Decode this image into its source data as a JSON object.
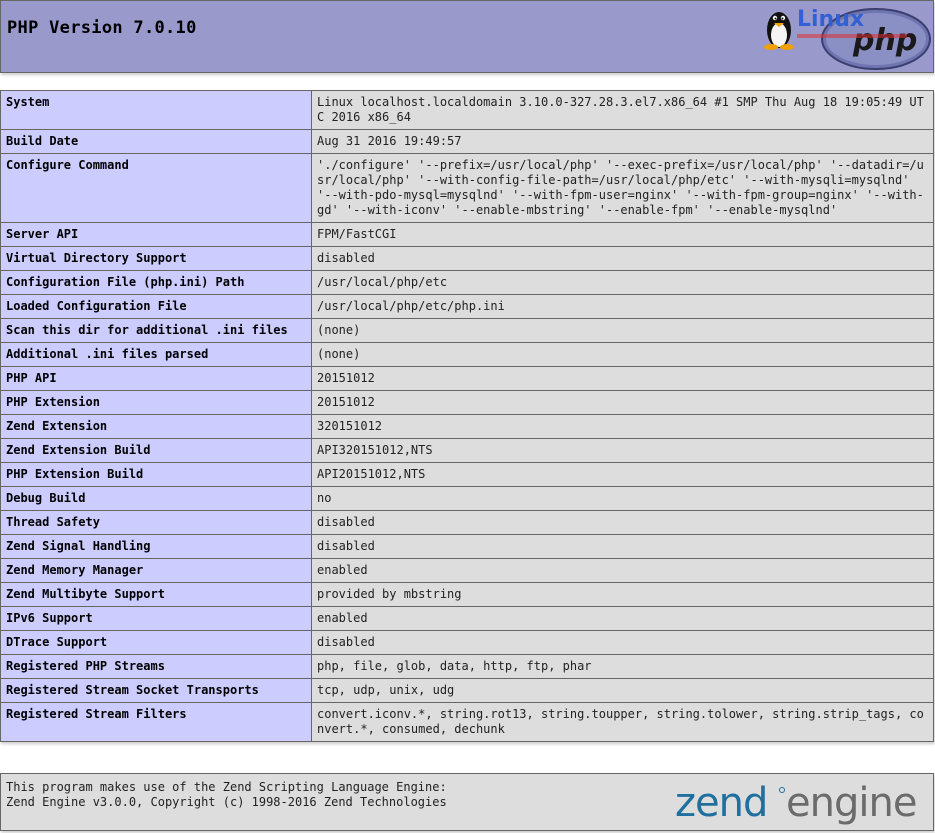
{
  "header": {
    "title": "PHP Version 7.0.10",
    "logo_text": "php",
    "watermark_text": "Linux"
  },
  "rows": [
    {
      "label": "System",
      "value": "Linux localhost.localdomain 3.10.0-327.28.3.el7.x86_64 #1 SMP Thu Aug 18 19:05:49 UTC 2016 x86_64"
    },
    {
      "label": "Build Date",
      "value": "Aug 31 2016 19:49:57"
    },
    {
      "label": "Configure Command",
      "value": "'./configure' '--prefix=/usr/local/php' '--exec-prefix=/usr/local/php' '--datadir=/usr/local/php' '--with-config-file-path=/usr/local/php/etc' '--with-mysqli=mysqlnd' '--with-pdo-mysql=mysqlnd' '--with-fpm-user=nginx' '--with-fpm-group=nginx' '--with-gd' '--with-iconv' '--enable-mbstring' '--enable-fpm' '--enable-mysqlnd'"
    },
    {
      "label": "Server API",
      "value": "FPM/FastCGI"
    },
    {
      "label": "Virtual Directory Support",
      "value": "disabled"
    },
    {
      "label": "Configuration File (php.ini) Path",
      "value": "/usr/local/php/etc"
    },
    {
      "label": "Loaded Configuration File",
      "value": "/usr/local/php/etc/php.ini"
    },
    {
      "label": "Scan this dir for additional .ini files",
      "value": "(none)"
    },
    {
      "label": "Additional .ini files parsed",
      "value": "(none)"
    },
    {
      "label": "PHP API",
      "value": "20151012"
    },
    {
      "label": "PHP Extension",
      "value": "20151012"
    },
    {
      "label": "Zend Extension",
      "value": "320151012"
    },
    {
      "label": "Zend Extension Build",
      "value": "API320151012,NTS"
    },
    {
      "label": "PHP Extension Build",
      "value": "API20151012,NTS"
    },
    {
      "label": "Debug Build",
      "value": "no"
    },
    {
      "label": "Thread Safety",
      "value": "disabled"
    },
    {
      "label": "Zend Signal Handling",
      "value": "disabled"
    },
    {
      "label": "Zend Memory Manager",
      "value": "enabled"
    },
    {
      "label": "Zend Multibyte Support",
      "value": "provided by mbstring"
    },
    {
      "label": "IPv6 Support",
      "value": "enabled"
    },
    {
      "label": "DTrace Support",
      "value": "disabled"
    },
    {
      "label": "Registered PHP Streams",
      "value": "php, file, glob, data, http, ftp, phar"
    },
    {
      "label": "Registered Stream Socket Transports",
      "value": "tcp, udp, unix, udg"
    },
    {
      "label": "Registered Stream Filters",
      "value": "convert.iconv.*, string.rot13, string.toupper, string.tolower, string.strip_tags, convert.*, consumed, dechunk"
    }
  ],
  "footer": {
    "line1": "This program makes use of the Zend Scripting Language Engine:",
    "line2": "Zend Engine v3.0.0, Copyright (c) 1998-2016 Zend Technologies",
    "logo_zend": "zend",
    "logo_engine": "engine"
  },
  "colors": {
    "header_bg": "#9999cc",
    "label_bg": "#ccccff",
    "value_bg": "#dddddd",
    "zend_blue": "#1f6f9f",
    "engine_gray": "#6b6b6b"
  }
}
